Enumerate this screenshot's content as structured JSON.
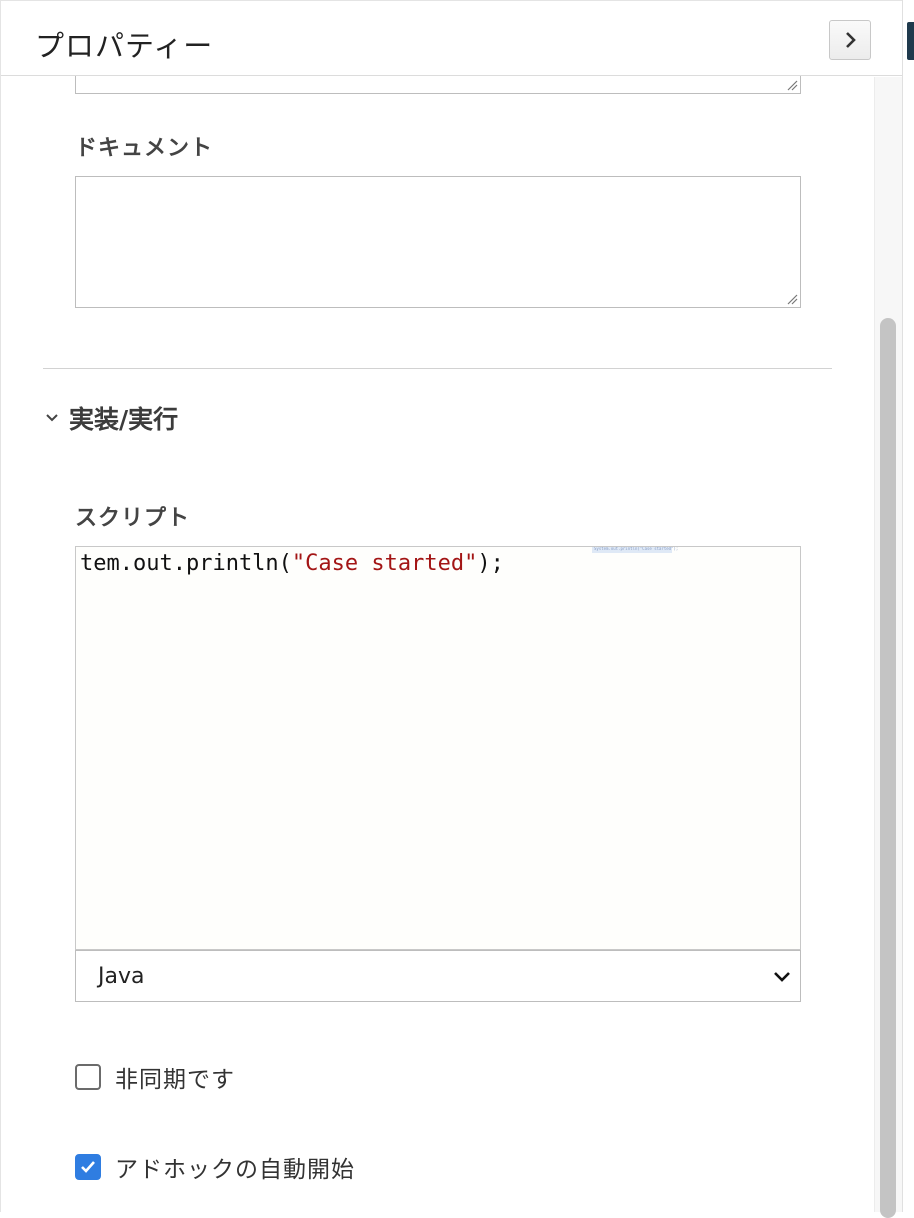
{
  "panel": {
    "title": "プロパティー",
    "collapse_icon": "chevron-right-icon"
  },
  "documentation": {
    "label": "ドキュメント",
    "value": ""
  },
  "implementation": {
    "section_title": "実装/実行",
    "toggle_icon": "chevron-down-icon",
    "script_label": "スクリプト",
    "code": {
      "prefix": "tem.out.println(",
      "string": "\"Case started\"",
      "suffix": ");"
    },
    "minimap_text": "System.out.println(\"Case started\");",
    "language": {
      "selected": "Java",
      "icon": "chevron-down-icon"
    }
  },
  "options": {
    "async": {
      "label": "非同期です",
      "checked": false
    },
    "adhoc_autostart": {
      "label": "アドホックの自動開始",
      "checked": true
    }
  },
  "colors": {
    "accent": "#2f7de1",
    "string_literal": "#a31515",
    "side_accent": "#1f3a4d"
  }
}
